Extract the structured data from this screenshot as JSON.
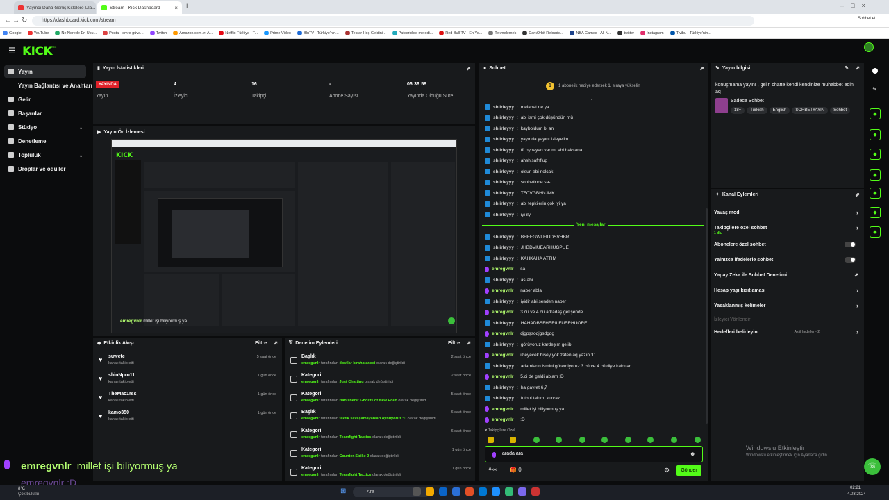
{
  "browser": {
    "tabs": [
      {
        "label": "Yayıncı Daha Geniş Kitlelere Ula...",
        "active": false
      },
      {
        "label": "Stream - Kick Dashboard",
        "active": true
      }
    ],
    "url": "https://dashboard.kick.com/stream",
    "bookmarks": [
      "Google",
      "YouTube",
      "Ne Nerede En Ucu...",
      "Posta - emre güve...",
      "Twitch",
      "Amazon.com.tr: A...",
      "Netflix Türkiye - T...",
      "Prime Video",
      "BluTV - Türkiye'nin...",
      "Tekrar Hoş Geldini...",
      "Patesrid'de melodi...",
      "Red Bull TV - En Ye...",
      "Tekmelemek",
      "DarkOrbit Reloade...",
      "NBA Games - All N...",
      "twitter",
      "Instagram",
      "Tivibu - Türkiye'nin..."
    ],
    "profile_label": "Sohbet et"
  },
  "nav": {
    "logo": "KICK",
    "logo_badge": "BETA"
  },
  "sidebar": {
    "items": [
      {
        "label": "Yayın",
        "active": true
      },
      {
        "label": "Yayın Bağlantısı ve Anahtarı",
        "active": false
      },
      {
        "label": "Gelir",
        "active": false
      },
      {
        "label": "Başarılar",
        "active": false
      },
      {
        "label": "Stüdyo",
        "active": false,
        "expand": "⌄"
      },
      {
        "label": "Denetleme",
        "active": false
      },
      {
        "label": "Topluluk",
        "active": false,
        "expand": "⌄"
      },
      {
        "label": "Droplar ve ödüller",
        "active": false
      }
    ]
  },
  "stats": {
    "title": "Yayın İstatistikleri",
    "live_badge": "YAYINDA",
    "items": [
      {
        "value": "",
        "label": "Yayın"
      },
      {
        "value": "4",
        "label": "İzleyici"
      },
      {
        "value": "16",
        "label": "Takipçi"
      },
      {
        "value": "-",
        "label": "Abone Sayısı"
      },
      {
        "value": "06:36:58",
        "label": "Yayında Olduğu Süre"
      }
    ]
  },
  "preview": {
    "title": "Yayın Ön İzlemesi",
    "overlay_user": "emregvnlr",
    "overlay_msg": "millet işi biliyormuş ya"
  },
  "events": {
    "title": "Etkinlik Akışı",
    "filter": "Filtre",
    "items": [
      {
        "name": "suwete",
        "sub": "kanalı takip etti",
        "time": "5 saat önce"
      },
      {
        "name": "shinNpro11",
        "sub": "kanalı takip etti",
        "time": "1 gün önce"
      },
      {
        "name": "TheMac1rss",
        "sub": "kanalı takip etti",
        "time": "1 gün önce"
      },
      {
        "name": "kamo350",
        "sub": "kanalı takip etti",
        "time": "1 gün önce"
      }
    ]
  },
  "moderation": {
    "title": "Denetim Eylemleri",
    "filter": "Filtre",
    "by_word": "tarafından",
    "items": [
      {
        "type": "Başlık",
        "user": "emregvnlr",
        "value": "dostlar kırahatanesi",
        "suffix": "olarak değiştirildi",
        "time": "2 saat önce"
      },
      {
        "type": "Kategori",
        "user": "emregvnlr",
        "value": "Just Chatting",
        "suffix": "olarak değiştirildi",
        "time": "2 saat önce"
      },
      {
        "type": "Kategori",
        "user": "emregvnlr",
        "value": "Banishers: Ghosts of New Eden",
        "suffix": "olarak değiştirildi",
        "time": "5 saat önce"
      },
      {
        "type": "Başlık",
        "user": "emregvnlr",
        "value": "taktik savaşamayanları oynuyoruz :D",
        "suffix": "olarak değiştirildi",
        "time": "6 saat önce"
      },
      {
        "type": "Kategori",
        "user": "emregvnlr",
        "value": "Teamfight Tactics",
        "suffix": "olarak değiştirildi",
        "time": "6 saat önce"
      },
      {
        "type": "Kategori",
        "user": "emregvnlr",
        "value": "Counter-Strike 2",
        "suffix": "olarak değiştirildi",
        "time": "1 gün önce"
      },
      {
        "type": "Kategori",
        "user": "emregvnlr",
        "value": "Teamfight Tactics",
        "suffix": "olarak değiştirildi",
        "time": "1 gün önce"
      }
    ]
  },
  "chat": {
    "title": "Sohbet",
    "gift_banner": "1 abonelik hediye edersek 1. sıraya yükselin",
    "new_messages": "Yeni mesajlar",
    "messages": [
      {
        "user": "shiirleyyy",
        "text": "melahat ne ya",
        "kind": "sub"
      },
      {
        "user": "shiirleyyy",
        "text": "abi ismi çok düşündün mü",
        "kind": "sub"
      },
      {
        "user": "shiirleyyy",
        "text": "kayboldum bi an",
        "kind": "sub"
      },
      {
        "user": "shiirleyyy",
        "text": "yayında yayını izleyelim",
        "kind": "sub"
      },
      {
        "user": "shiirleyyy",
        "text": "tft oynayan var mı abi baksana",
        "kind": "sub"
      },
      {
        "user": "shiirleyyy",
        "text": "ahshjsafhflug",
        "kind": "sub"
      },
      {
        "user": "shiirleyyy",
        "text": "olsun abi nolcak",
        "kind": "sub"
      },
      {
        "user": "shiirleyyy",
        "text": "sohbetinde sa-",
        "kind": "sub"
      },
      {
        "user": "shiirleyyy",
        "text": "TFCVGBHNJMK",
        "kind": "sub"
      },
      {
        "user": "shiirleyyy",
        "text": "abi tepkilerin çok iyi ya",
        "kind": "sub"
      },
      {
        "user": "shiirleyyy",
        "text": "iyi ily",
        "kind": "sub"
      },
      {
        "user": "shiirleyyy",
        "text": "BHFEGWLFIUDSVHBR",
        "kind": "sub"
      },
      {
        "user": "shiirleyyy",
        "text": "JHBDVIUEARHUGPUE",
        "kind": "sub"
      },
      {
        "user": "shiirleyyy",
        "text": "KAHKAHA ATTIM",
        "kind": "sub"
      },
      {
        "user": "emregvnlr",
        "text": "sa",
        "kind": "mic"
      },
      {
        "user": "shiirleyyy",
        "text": "as abi",
        "kind": "sub"
      },
      {
        "user": "emregvnlr",
        "text": "naber abla",
        "kind": "mic"
      },
      {
        "user": "shiirleyyy",
        "text": "iyidir abi senden naber",
        "kind": "sub"
      },
      {
        "user": "emregvnlr",
        "text": "3.cü ve 4.cü arkadaş gel şende",
        "kind": "mic"
      },
      {
        "user": "shiirleyyy",
        "text": "HAHADBSFHERILFUERHUORE",
        "kind": "sub"
      },
      {
        "user": "emregvnlr",
        "text": "djgpşsodjgsdgdg",
        "kind": "mic"
      },
      {
        "user": "shiirleyyy",
        "text": "görüyoruz kardeşim gelib",
        "kind": "sub"
      },
      {
        "user": "emregvnlr",
        "text": "izleyecek bişey yok zaten aq yazın :D",
        "kind": "mic"
      },
      {
        "user": "shiirleyyy",
        "text": "adamların ismini göremiyoruz 3.cü ve 4.cü diye kaldılar",
        "kind": "sub"
      },
      {
        "user": "emregvnlr",
        "text": "5.ci de geldi ablam :D",
        "kind": "mic"
      },
      {
        "user": "shiirleyyy",
        "text": "ha gayret 6,7",
        "kind": "sub"
      },
      {
        "user": "shiirleyyy",
        "text": "futbol takımı kurcaz",
        "kind": "sub"
      },
      {
        "user": "emregvnlr",
        "text": "millet işi biliyormuş ya",
        "kind": "mic"
      },
      {
        "user": "emregvnlr",
        "text": ":D",
        "kind": "mic"
      }
    ],
    "followers_only": "Takipçilere Özel",
    "input_value": "arada ara",
    "send": "Gönder",
    "count": "0"
  },
  "info": {
    "title": "Yayın bilgisi",
    "stream_title": "konuşmama yayını , gelin chatte kendi kendinize muhabbet edin aq",
    "category": "Sadece Sohbet",
    "tags": [
      "18+",
      "Turkish",
      "English",
      "SOHBETYAYIN",
      "Sohbet"
    ]
  },
  "channel_actions": {
    "title": "Kanal Eylemleri",
    "items": [
      {
        "label": "Yavaş mod",
        "control": "chevron",
        "sub": ""
      },
      {
        "label": "Takipçilere özel sohbet",
        "control": "chevron",
        "sub": "1 dk."
      },
      {
        "label": "Abonelere özel sohbet",
        "control": "toggle",
        "sub": ""
      },
      {
        "label": "Yalnızca ifadelerle sohbet",
        "control": "toggle",
        "sub": ""
      },
      {
        "label": "Yapay Zeka ile Sohbet Denetimi",
        "control": "external",
        "sub": ""
      },
      {
        "label": "Hesap yaşı kısıtlaması",
        "control": "chevron",
        "sub": ""
      },
      {
        "label": "Yasaklanmış kelimeler",
        "control": "chevron",
        "sub": ""
      },
      {
        "label": "İzleyici Yönlendir",
        "control": "none",
        "sub": ""
      },
      {
        "label": "Hedefleri belirleyin",
        "control": "goal",
        "sub": "Aktif hedefler - 2"
      }
    ]
  },
  "overlay": {
    "user": "emregvnlr",
    "msg": "millet işi biliyormuş ya",
    "user2": "emregvnlr",
    "msg2": ":D"
  },
  "windows": {
    "activate_title": "Windows'u Etkinleştir",
    "activate_sub": "Windows'u etkinleştirmek için Ayarlar'a gidin.",
    "weather_temp": "8°C",
    "weather_desc": "Çok bulutlu",
    "search": "Ara",
    "time": "02:21",
    "date": "4.03.2024"
  },
  "colors": {
    "accent": "#53fc18",
    "live": "#e0222a",
    "sub_badge": "#1f8ad8",
    "mic_badge": "#a040ff"
  }
}
